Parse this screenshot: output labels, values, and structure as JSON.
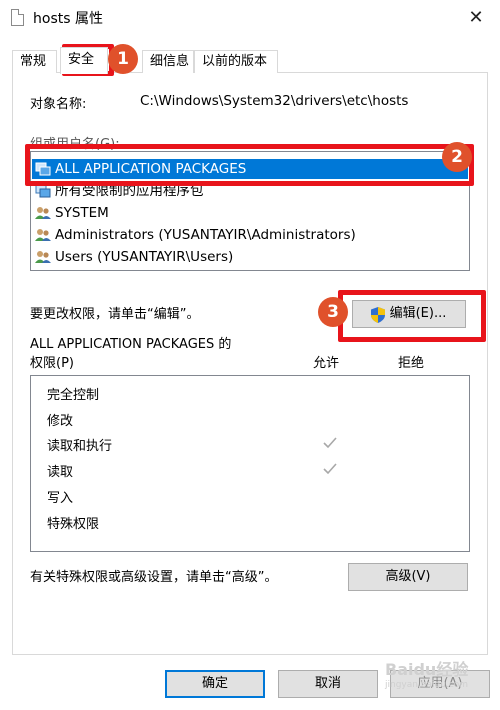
{
  "window": {
    "title": "hosts 属性",
    "close_glyph": "✕"
  },
  "tabs": [
    {
      "label": "常规"
    },
    {
      "label": "安全"
    },
    {
      "label": "细信息"
    },
    {
      "label": "以前的版本"
    }
  ],
  "object_name": {
    "label": "对象名称:",
    "value": "C:\\Windows\\System32\\drivers\\etc\\hosts"
  },
  "groups": {
    "label": "组或用户名(G):",
    "items": [
      {
        "name": "ALL APPLICATION PACKAGES",
        "icon": "app-packages-icon"
      },
      {
        "name": "所有受限制的应用程序包",
        "icon": "app-packages-icon"
      },
      {
        "name": "SYSTEM",
        "icon": "users-icon"
      },
      {
        "name": "Administrators (YUSANTAYIR\\Administrators)",
        "icon": "users-icon"
      },
      {
        "name": "Users (YUSANTAYIR\\Users)",
        "icon": "users-icon"
      }
    ]
  },
  "edit": {
    "hint": "要更改权限，请单击“编辑”。",
    "button_label": "编辑(E)..."
  },
  "permissions": {
    "title_line1": "ALL APPLICATION PACKAGES 的",
    "title_line2": "权限(P)",
    "col_allow": "允许",
    "col_deny": "拒绝",
    "rows": [
      {
        "name": "完全控制",
        "allow": false,
        "deny": false
      },
      {
        "name": "修改",
        "allow": false,
        "deny": false
      },
      {
        "name": "读取和执行",
        "allow": true,
        "deny": false
      },
      {
        "name": "读取",
        "allow": true,
        "deny": false
      },
      {
        "name": "写入",
        "allow": false,
        "deny": false
      },
      {
        "name": "特殊权限",
        "allow": false,
        "deny": false
      }
    ]
  },
  "advanced": {
    "hint": "有关特殊权限或高级设置，请单击“高级”。",
    "button_label": "高级(V)"
  },
  "footer": {
    "ok_label": "确定",
    "cancel_label": "取消",
    "apply_label": "应用(A)"
  },
  "annotations": {
    "step1": "1",
    "step2": "2",
    "step3": "3",
    "color": "#e8141b",
    "badge_color": "#e0512b"
  },
  "watermark": {
    "text": "Baidu经验",
    "sub": "jingyan.baidu.com"
  },
  "colors": {
    "selection": "#0078d7",
    "button_face": "#e1e1e1",
    "border": "#d9d9d9"
  }
}
